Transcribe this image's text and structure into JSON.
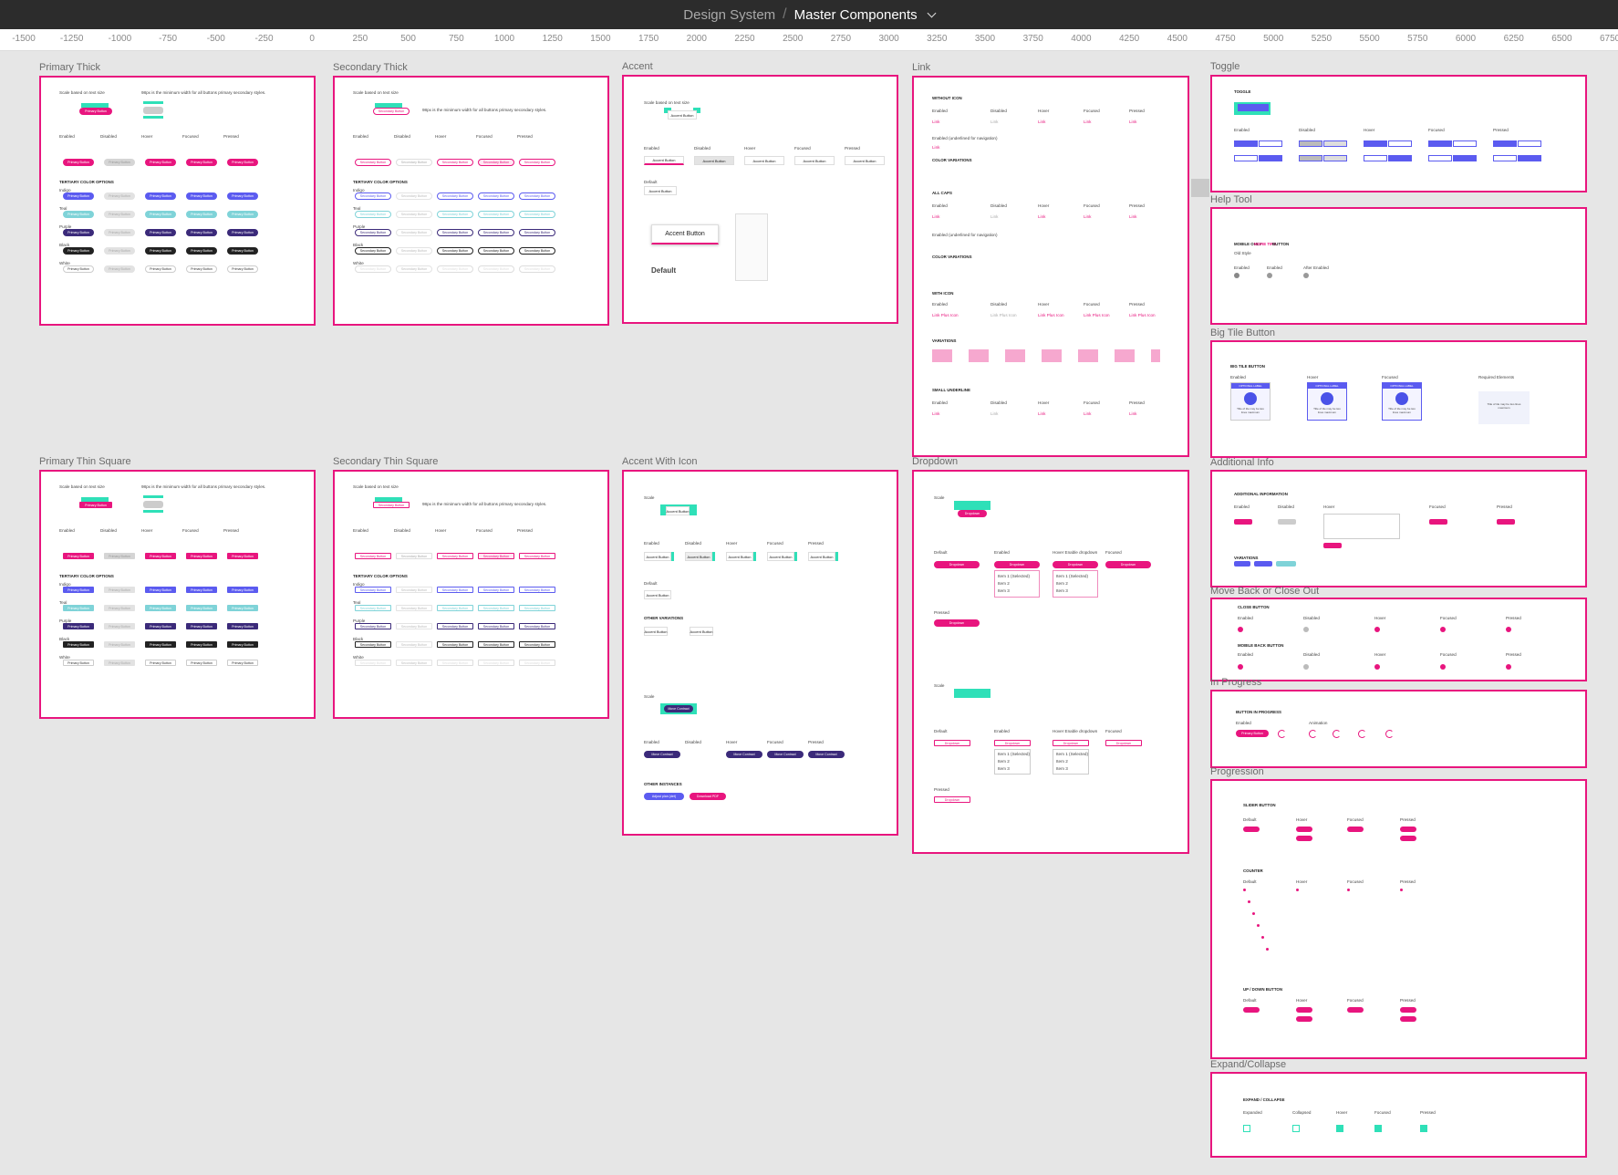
{
  "header": {
    "breadcrumb_root": "Design System",
    "separator": "/",
    "current_page": "Master Components",
    "chevron_icon": "chevron-down-icon"
  },
  "ruler": {
    "ticks": [
      "-1500",
      "-1250",
      "-1000",
      "-750",
      "-500",
      "-250",
      "0",
      "250",
      "500",
      "750",
      "1000",
      "1250",
      "1500",
      "1750",
      "2000",
      "2250",
      "2500",
      "2750",
      "3000",
      "3250",
      "3500",
      "3750",
      "4000",
      "4250",
      "4500",
      "4750",
      "5000",
      "5250",
      "5500",
      "5750",
      "6000",
      "6250",
      "6500",
      "6750"
    ]
  },
  "colors": {
    "accent_pink": "#e8157e",
    "mint": "#2fe0b8",
    "indigo": "#5b5bf0",
    "teal": "#7fd3d8",
    "purple": "#3b2a7a",
    "black": "#222222"
  },
  "states": [
    "Enabled",
    "Disabled",
    "Hover",
    "Focused",
    "Pressed"
  ],
  "frames": {
    "primary_thick": "Primary Thick",
    "secondary_thick": "Secondary Thick",
    "accent": "Accent",
    "link": "Link",
    "toggle": "Toggle",
    "help_tool": "Help Tool",
    "big_tile_button": "Big Tile Button",
    "additional_info": "Additional Info",
    "move_back": "Move Back or Close Out",
    "in_progress": "In Progress",
    "progression": "Progression",
    "expand_collapse": "Expand/Collapse",
    "primary_thin_square": "Primary Thin Square",
    "secondary_thin_square": "Secondary Thin Square",
    "accent_with_icon": "Accent With Icon",
    "dropdown": "Dropdown"
  },
  "text": {
    "scale_note": "Scale based on text size",
    "min_width_note": "98px is the minimum width for all buttons primary secondary styles.",
    "min_width_note2": "98px is the minimum width for all buttons primary secondary styles.",
    "tertiary": "TERTIARY COLOR OPTIONS",
    "indigo": "Indigo",
    "teal": "Teal",
    "purple": "Purple",
    "black": "Black",
    "white": "White",
    "primary_button": "Primary Button",
    "secondary_button": "Secondary Button",
    "accent_button": "Accent Button",
    "default": "Default",
    "scale": "Scale",
    "other_variations": "OTHER VARIATIONS",
    "other_instances": "OTHER INSTANCES",
    "move_contract": "Move Contract",
    "adjust_plan": "Adjust plan (det)",
    "download_pdf": "Download PDF",
    "without_icon": "WITHOUT ICON",
    "with_icon": "WITH ICON",
    "all_caps": "ALL CAPS",
    "color_variations": "COLOR VARIATIONS",
    "variations": "VARIATIONS",
    "small_underline": "SMALL UNDERLINE",
    "enabled_no_underline": "Enabled (no underline)",
    "enabled_underline": "Enabled (underlined for navigation)",
    "link": "Link",
    "link_plus_icon": "Link Plus Icon",
    "toggle_hd": "TOGGLE",
    "mobile_only": "MOBILE ONLY",
    "more_tips": "MORE TIPS",
    "button_word": "BUTTON",
    "old_style": "Old Style",
    "after_enabled": "After Enabled",
    "big_tile_hd": "BIG TILE BUTTON",
    "optional_label": "OPTIONAL LABEL",
    "tile_text": "Title of tile may be two lines maximum",
    "required_elements": "Required Elements",
    "additional_info_hd": "ADDITIONAL INFORMATION",
    "variations_hd": "VARIATIONS",
    "close_button": "CLOSE BUTTON",
    "mobile_back": "MOBILE BACK BUTTON",
    "button_in_progress": "BUTTON IN PROGRESS",
    "animation": "Animation",
    "slider_button": "SLIDER BUTTON",
    "counter": "COUNTER",
    "up_down": "UP / DOWN BUTTON",
    "expand_collapse_hd": "EXPAND / COLLAPSE",
    "expanded": "Expanded",
    "collapsed": "Collapsed",
    "dropdown": "Dropdown",
    "hover_enable_dropdown": "Hover Enable dropdown",
    "item_selected": "Item 1 (Selected)",
    "item2": "Item 2",
    "item3": "Item 3"
  }
}
